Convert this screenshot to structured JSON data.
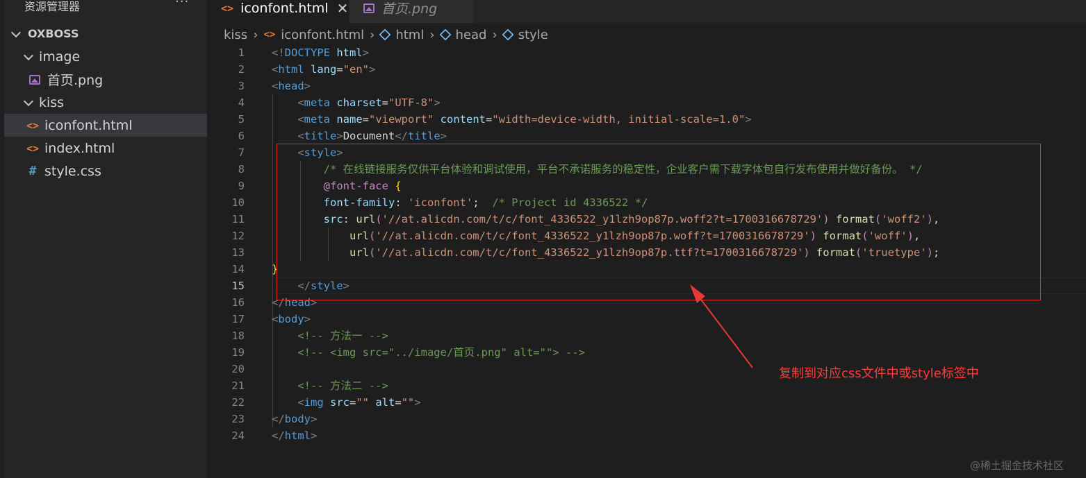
{
  "explorer": {
    "title": "资源管理器",
    "more": "···",
    "tree": [
      {
        "label": "OXBOSS",
        "kind": "root"
      },
      {
        "label": "image",
        "kind": "folder"
      },
      {
        "label": "首页.png",
        "kind": "image"
      },
      {
        "label": "kiss",
        "kind": "folder"
      },
      {
        "label": "iconfont.html",
        "kind": "html",
        "active": true
      },
      {
        "label": "index.html",
        "kind": "html"
      },
      {
        "label": "style.css",
        "kind": "css"
      }
    ]
  },
  "tabs": [
    {
      "label": "iconfont.html",
      "icon": "html-icon",
      "active": true,
      "close": "✕"
    },
    {
      "label": "首页.png",
      "icon": "image-icon",
      "active": false
    }
  ],
  "breadcrumb": [
    "kiss",
    "iconfont.html",
    "html",
    "head",
    "style"
  ],
  "editor": {
    "current_line": "15",
    "lines": [
      {
        "n": "1",
        "tokens": [
          [
            "p",
            "<!"
          ],
          [
            "t",
            "DOCTYPE "
          ],
          [
            "a",
            "html"
          ],
          [
            "p",
            ">"
          ]
        ]
      },
      {
        "n": "2",
        "tokens": [
          [
            "p",
            "<"
          ],
          [
            "t",
            "html "
          ],
          [
            "a",
            "lang"
          ],
          [
            "tx",
            "="
          ],
          [
            "s",
            "\"en\""
          ],
          [
            "p",
            ">"
          ]
        ]
      },
      {
        "n": "3",
        "tokens": [
          [
            "p",
            "<"
          ],
          [
            "t",
            "head"
          ],
          [
            "p",
            ">"
          ]
        ]
      },
      {
        "n": "4",
        "tokens": [
          [
            "tx",
            "    "
          ],
          [
            "p",
            "<"
          ],
          [
            "t",
            "meta "
          ],
          [
            "a",
            "charset"
          ],
          [
            "tx",
            "="
          ],
          [
            "s",
            "\"UTF-8\""
          ],
          [
            "p",
            ">"
          ]
        ]
      },
      {
        "n": "5",
        "tokens": [
          [
            "tx",
            "    "
          ],
          [
            "p",
            "<"
          ],
          [
            "t",
            "meta "
          ],
          [
            "a",
            "name"
          ],
          [
            "tx",
            "="
          ],
          [
            "s",
            "\"viewport\" "
          ],
          [
            "a",
            "content"
          ],
          [
            "tx",
            "="
          ],
          [
            "s",
            "\"width=device-width, initial-scale=1.0\""
          ],
          [
            "p",
            ">"
          ]
        ]
      },
      {
        "n": "6",
        "tokens": [
          [
            "tx",
            "    "
          ],
          [
            "p",
            "<"
          ],
          [
            "t",
            "title"
          ],
          [
            "p",
            ">"
          ],
          [
            "tx",
            "Document"
          ],
          [
            "p",
            "</"
          ],
          [
            "t",
            "title"
          ],
          [
            "p",
            ">"
          ]
        ]
      },
      {
        "n": "7",
        "tokens": [
          [
            "tx",
            "    "
          ],
          [
            "p",
            "<"
          ],
          [
            "t",
            "style"
          ],
          [
            "p",
            ">"
          ]
        ]
      },
      {
        "n": "8",
        "tokens": [
          [
            "tx",
            "        "
          ],
          [
            "c",
            "/* 在线链接服务仅供平台体验和调试使用，平台不承诺服务的稳定性，企业客户需下载字体包自行发布使用并做好备份。 */"
          ]
        ]
      },
      {
        "n": "9",
        "tokens": [
          [
            "tx",
            "        "
          ],
          [
            "k",
            "@font-face "
          ],
          [
            "y",
            "{"
          ]
        ]
      },
      {
        "n": "10",
        "tokens": [
          [
            "tx",
            "        "
          ],
          [
            "a",
            "font-family"
          ],
          [
            "tx",
            ": "
          ],
          [
            "s",
            "'iconfont'"
          ],
          [
            "tx",
            ";  "
          ],
          [
            "c",
            "/* Project id 4336522 */"
          ]
        ]
      },
      {
        "n": "11",
        "tokens": [
          [
            "tx",
            "        "
          ],
          [
            "a",
            "src"
          ],
          [
            "tx",
            ": "
          ],
          [
            "f",
            "url"
          ],
          [
            "k",
            "("
          ],
          [
            "s",
            "'//at.alicdn.com/t/c/font_4336522_y1lzh9op87p.woff2?t=1700316678729'"
          ],
          [
            "k",
            ")"
          ],
          [
            "tx",
            " "
          ],
          [
            "f",
            "format"
          ],
          [
            "k",
            "("
          ],
          [
            "s",
            "'woff2'"
          ],
          [
            "k",
            ")"
          ],
          [
            "tx",
            ","
          ]
        ]
      },
      {
        "n": "12",
        "tokens": [
          [
            "tx",
            "            "
          ],
          [
            "f",
            "url"
          ],
          [
            "k",
            "("
          ],
          [
            "s",
            "'//at.alicdn.com/t/c/font_4336522_y1lzh9op87p.woff?t=1700316678729'"
          ],
          [
            "k",
            ")"
          ],
          [
            "tx",
            " "
          ],
          [
            "f",
            "format"
          ],
          [
            "k",
            "("
          ],
          [
            "s",
            "'woff'"
          ],
          [
            "k",
            ")"
          ],
          [
            "tx",
            ","
          ]
        ]
      },
      {
        "n": "13",
        "tokens": [
          [
            "tx",
            "            "
          ],
          [
            "f",
            "url"
          ],
          [
            "k",
            "("
          ],
          [
            "s",
            "'//at.alicdn.com/t/c/font_4336522_y1lzh9op87p.ttf?t=1700316678729'"
          ],
          [
            "k",
            ")"
          ],
          [
            "tx",
            " "
          ],
          [
            "f",
            "format"
          ],
          [
            "k",
            "("
          ],
          [
            "s",
            "'truetype'"
          ],
          [
            "k",
            ")"
          ],
          [
            "tx",
            ";"
          ]
        ]
      },
      {
        "n": "14",
        "tokens": [
          [
            "y",
            "}"
          ]
        ]
      },
      {
        "n": "15",
        "tokens": [
          [
            "tx",
            "    "
          ],
          [
            "p",
            "</"
          ],
          [
            "t",
            "style"
          ],
          [
            "p",
            ">"
          ]
        ]
      },
      {
        "n": "16",
        "tokens": [
          [
            "p",
            "</"
          ],
          [
            "t",
            "head"
          ],
          [
            "p",
            ">"
          ]
        ]
      },
      {
        "n": "17",
        "tokens": [
          [
            "p",
            "<"
          ],
          [
            "t",
            "body"
          ],
          [
            "p",
            ">"
          ]
        ]
      },
      {
        "n": "18",
        "tokens": [
          [
            "tx",
            "    "
          ],
          [
            "c",
            "<!-- 方法一 -->"
          ]
        ]
      },
      {
        "n": "19",
        "tokens": [
          [
            "tx",
            "    "
          ],
          [
            "c",
            "<!-- <img src=\"../image/首页.png\" alt=\"\"> -->"
          ]
        ]
      },
      {
        "n": "20",
        "tokens": []
      },
      {
        "n": "21",
        "tokens": [
          [
            "tx",
            "    "
          ],
          [
            "c",
            "<!-- 方法二 -->"
          ]
        ]
      },
      {
        "n": "22",
        "tokens": [
          [
            "tx",
            "    "
          ],
          [
            "p",
            "<"
          ],
          [
            "t",
            "img "
          ],
          [
            "a",
            "src"
          ],
          [
            "tx",
            "="
          ],
          [
            "s",
            "\"\" "
          ],
          [
            "a",
            "alt"
          ],
          [
            "tx",
            "="
          ],
          [
            "s",
            "\"\""
          ],
          [
            "p",
            ">"
          ]
        ]
      },
      {
        "n": "23",
        "tokens": [
          [
            "p",
            "</"
          ],
          [
            "t",
            "body"
          ],
          [
            "p",
            ">"
          ]
        ]
      },
      {
        "n": "24",
        "tokens": [
          [
            "p",
            "</"
          ],
          [
            "t",
            "html"
          ],
          [
            "p",
            ">"
          ]
        ]
      }
    ]
  },
  "annotation": {
    "text": "复制到对应css文件中或style标签中",
    "color": "#ff3b3b"
  },
  "watermark": "@稀土掘金技术社区",
  "colors": {
    "editor_bg": "#1e1e1e",
    "sidebar_bg": "#252526",
    "highlight_box": "#e03030"
  }
}
